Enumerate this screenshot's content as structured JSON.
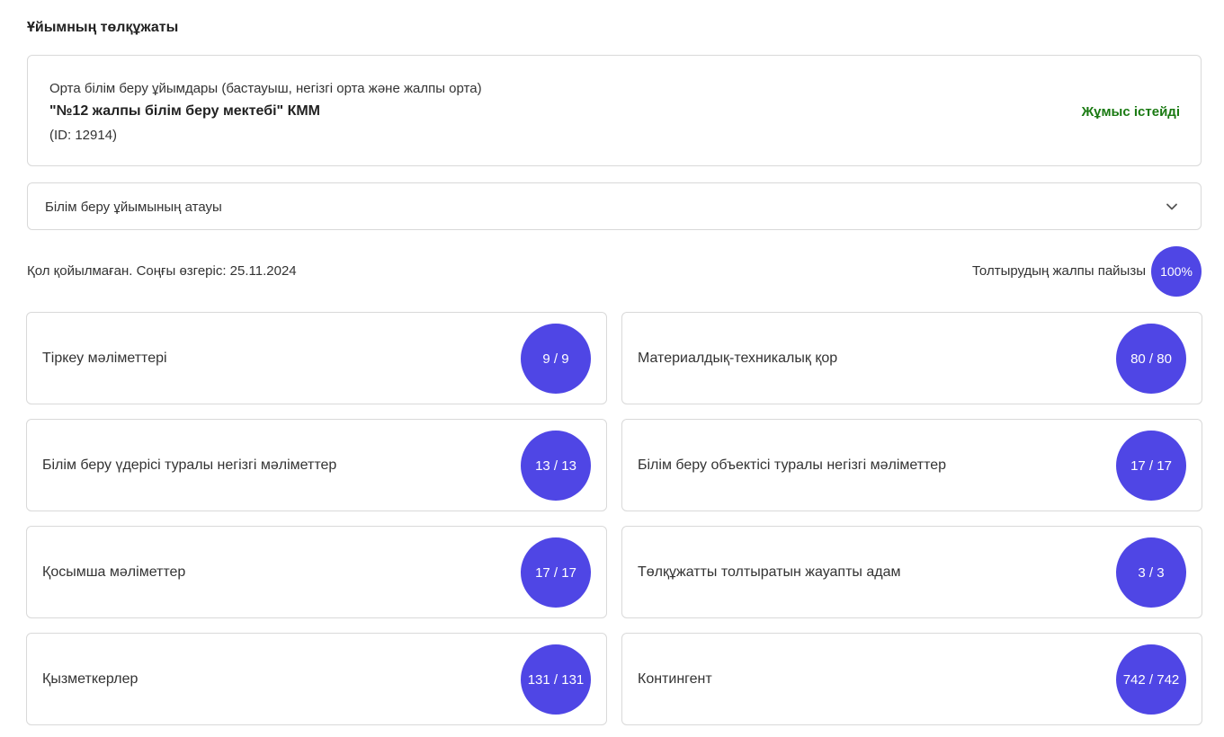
{
  "page": {
    "title": "Ұйымның төлқұжаты"
  },
  "organization": {
    "type": "Орта білім беру ұйымдары (бастауыш, негізгі орта және жалпы орта)",
    "name": "\"№12 жалпы білім беру мектебі\" КММ",
    "id_text": "(ID: 12914)",
    "status": "Жұмыс істейді",
    "status_color": "#1a7a12"
  },
  "accordion": {
    "label": "Білім беру ұйымының атауы",
    "icon": "chevron-down-icon"
  },
  "summary": {
    "sign_status": "Қол қойылмаған. Соңғы өзгеріс: 25.11.2024",
    "total_label": "Толтырудың жалпы пайызы",
    "total_percent": "100%"
  },
  "sections": [
    {
      "label": "Тіркеу мәліметтері",
      "progress": "9 / 9"
    },
    {
      "label": "Материалдық-техникалық қор",
      "progress": "80 / 80"
    },
    {
      "label": "Білім беру үдерісі туралы негізгі мәліметтер",
      "progress": "13 / 13"
    },
    {
      "label": "Білім беру объектісі туралы негізгі мәліметтер",
      "progress": "17 / 17"
    },
    {
      "label": "Қосымша мәліметтер",
      "progress": "17 / 17"
    },
    {
      "label": "Төлқұжатты толтыратын жауапты адам",
      "progress": "3 / 3"
    },
    {
      "label": "Қызметкерлер",
      "progress": "131 / 131"
    },
    {
      "label": "Контингент",
      "progress": "742 / 742"
    }
  ],
  "colors": {
    "accent": "#4f46e5",
    "border": "#d9d9d9"
  }
}
